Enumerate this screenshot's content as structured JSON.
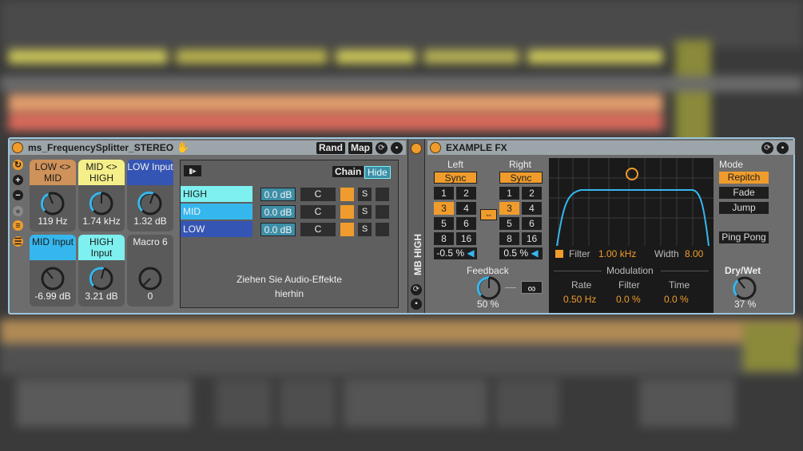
{
  "colors": {
    "accent_orange": "#f09c2c",
    "high": "#7ef0f0",
    "mid": "#35b7ee",
    "low": "#3555b5",
    "frame_border": "#9bc6de"
  },
  "device1": {
    "title": "ms_FrequencySplitter_STEREO",
    "rand_label": "Rand",
    "map_label": "Map",
    "macros": [
      {
        "label": "LOW <> MID",
        "value": "119 Hz",
        "color": "#cf925a"
      },
      {
        "label": "MID <> HIGH",
        "value": "1.74 kHz",
        "color": "#f5ef8a"
      },
      {
        "label": "LOW Input",
        "value": "1.32 dB",
        "color": "#3555b5"
      },
      {
        "label": "MID Input",
        "value": "-6.99 dB",
        "color": "#35b7ee"
      },
      {
        "label": "HIGH Input",
        "value": "3.21 dB",
        "color": "#7ef0f0"
      },
      {
        "label": "Macro 6",
        "value": "0",
        "color": "#5a5a5a"
      }
    ],
    "chain_label": "Chain",
    "hide_label": "Hide",
    "chains": [
      {
        "name": "HIGH",
        "vol": "0.0 dB",
        "pan": "C",
        "solo": "S"
      },
      {
        "name": "MID",
        "vol": "0.0 dB",
        "pan": "C",
        "solo": "S"
      },
      {
        "name": "LOW",
        "vol": "0.0 dB",
        "pan": "C",
        "solo": "S"
      }
    ],
    "drop_hint_line1": "Ziehen Sie Audio-Effekte",
    "drop_hint_line2": "hierhin"
  },
  "chain_tab": {
    "label": "MB HIGH"
  },
  "device2": {
    "title": "EXAMPLE FX",
    "left": {
      "label": "Left",
      "sync": "Sync",
      "nums": [
        "1",
        "2",
        "3",
        "4",
        "5",
        "6",
        "8",
        "16"
      ],
      "active": "3",
      "offset": "-0.5 %"
    },
    "right": {
      "label": "Right",
      "sync": "Sync",
      "nums": [
        "1",
        "2",
        "3",
        "4",
        "5",
        "6",
        "8",
        "16"
      ],
      "active": "3",
      "offset": "0.5 %"
    },
    "feedback": {
      "label": "Feedback",
      "value": "50 %",
      "infinity": "∞"
    },
    "filter": {
      "label": "Filter",
      "freq": "1.00 kHz",
      "width_label": "Width",
      "width": "8.00"
    },
    "modulation": {
      "label": "Modulation",
      "rate_label": "Rate",
      "filter_label": "Filter",
      "time_label": "Time",
      "rate": "0.50 Hz",
      "filter": "0.0 %",
      "time": "0.0 %"
    },
    "mode": {
      "label": "Mode",
      "options": [
        "Repitch",
        "Fade",
        "Jump"
      ],
      "selected": "Repitch",
      "ping_pong": "Ping Pong"
    },
    "drywet": {
      "label": "Dry/Wet",
      "value": "37 %"
    }
  }
}
